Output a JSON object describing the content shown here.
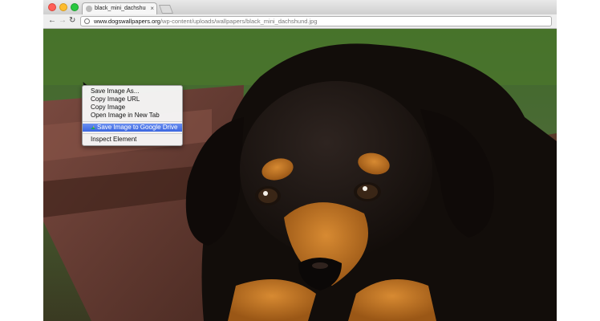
{
  "tab": {
    "title": "black_mini_dachshund_pup",
    "close": "×"
  },
  "nav": {
    "back": "←",
    "forward": "→",
    "reload": "↻"
  },
  "address": {
    "host": "www.dogswallpapers.org",
    "path": "/wp-content/uploads/wallpapers/black_mini_dachshund.jpg"
  },
  "context_menu": {
    "items": [
      {
        "label": "Save Image As..."
      },
      {
        "label": "Copy Image URL"
      },
      {
        "label": "Copy Image"
      },
      {
        "label": "Open Image in New Tab"
      },
      {
        "label": "Save Image to Google Drive",
        "highlighted": true
      },
      {
        "label": "Inspect Element"
      }
    ]
  },
  "colors": {
    "highlight": "#3b66e0",
    "menu_bg": "#f6f6f6",
    "dog_tan": "#c4741e",
    "dog_black": "#17110d"
  }
}
